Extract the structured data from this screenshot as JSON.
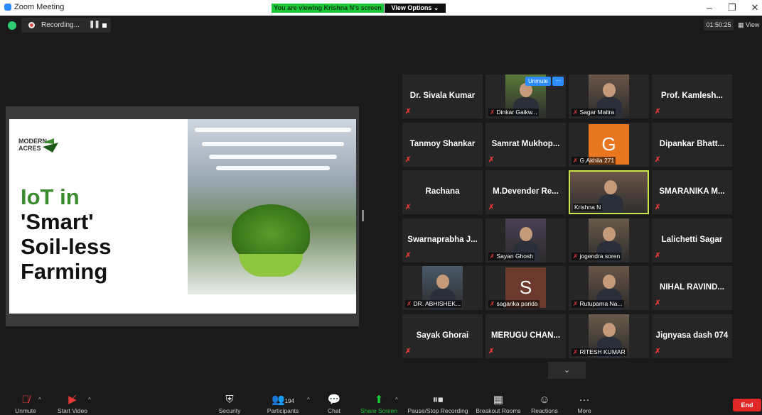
{
  "window": {
    "title": "Zoom Meeting",
    "viewing_banner": "You are viewing Krishna N's screen",
    "view_options": "View Options ⌄",
    "minimize": "–",
    "restore": "❐",
    "close": "✕"
  },
  "status": {
    "recording_label": "Recording...",
    "pause_glyph": "❚❚",
    "timer": "01:50:25",
    "view_label": "View"
  },
  "slide": {
    "brand_line1": "MODERN",
    "brand_line2": "ACRES",
    "title_line1": "IoT in",
    "title_line2": "'Smart'",
    "title_line3": "Soil-less",
    "title_line4": "Farming"
  },
  "participants_grid": {
    "unmute_popup": "Unmute",
    "more_popup": "···",
    "pager_glyph": "⌄",
    "tiles": [
      {
        "name": "Dr. Sivala Kumar",
        "kind": "name"
      },
      {
        "name": "Dinkar Gaikw...",
        "kind": "video"
      },
      {
        "name": "Sagar Maitra",
        "kind": "video"
      },
      {
        "name": "Prof. Kamlesh...",
        "kind": "name"
      },
      {
        "name": "Tanmoy Shankar",
        "kind": "name"
      },
      {
        "name": "Samrat Mukhop...",
        "kind": "name"
      },
      {
        "name": "G.Akhila 271",
        "kind": "avatar",
        "letter": "G",
        "color": "#e8761f"
      },
      {
        "name": "Dipankar Bhatt...",
        "kind": "name"
      },
      {
        "name": "Rachana",
        "kind": "name"
      },
      {
        "name": "M.Devender Re...",
        "kind": "name"
      },
      {
        "name": "Krishna N",
        "kind": "video",
        "active": true
      },
      {
        "name": "SMARANIKA M...",
        "kind": "name"
      },
      {
        "name": "Swarnaprabha J...",
        "kind": "name"
      },
      {
        "name": "Sayan Ghosh",
        "kind": "video"
      },
      {
        "name": "jogendra soren",
        "kind": "video"
      },
      {
        "name": "Lalichetti Sagar",
        "kind": "name"
      },
      {
        "name": "DR. ABHISHEK...",
        "kind": "video"
      },
      {
        "name": "sagarika parida",
        "kind": "avatar",
        "letter": "S",
        "color": "#6b3a2c"
      },
      {
        "name": "Rutuparna Na...",
        "kind": "video"
      },
      {
        "name": "NIHAL RAVIND...",
        "kind": "name"
      },
      {
        "name": "Sayak Ghorai",
        "kind": "name"
      },
      {
        "name": "MERUGU CHAN...",
        "kind": "name"
      },
      {
        "name": "RITESH KUMAR",
        "kind": "video"
      },
      {
        "name": "Jignyasa dash 074",
        "kind": "name"
      }
    ]
  },
  "toolbar": {
    "unmute": "Unmute",
    "start_video": "Start Video",
    "security": "Security",
    "participants": "Participants",
    "participants_count": "194",
    "chat": "Chat",
    "share_screen": "Share Screen",
    "pause_recording": "Pause/Stop Recording",
    "breakout": "Breakout Rooms",
    "reactions": "Reactions",
    "more": "More",
    "end": "End"
  },
  "colors": {
    "accent_blue": "#2d8cff",
    "green_banner": "#1cc83a",
    "muted_red": "#e53935",
    "active_speaker": "#c8e64a",
    "end_red": "#e02828"
  }
}
